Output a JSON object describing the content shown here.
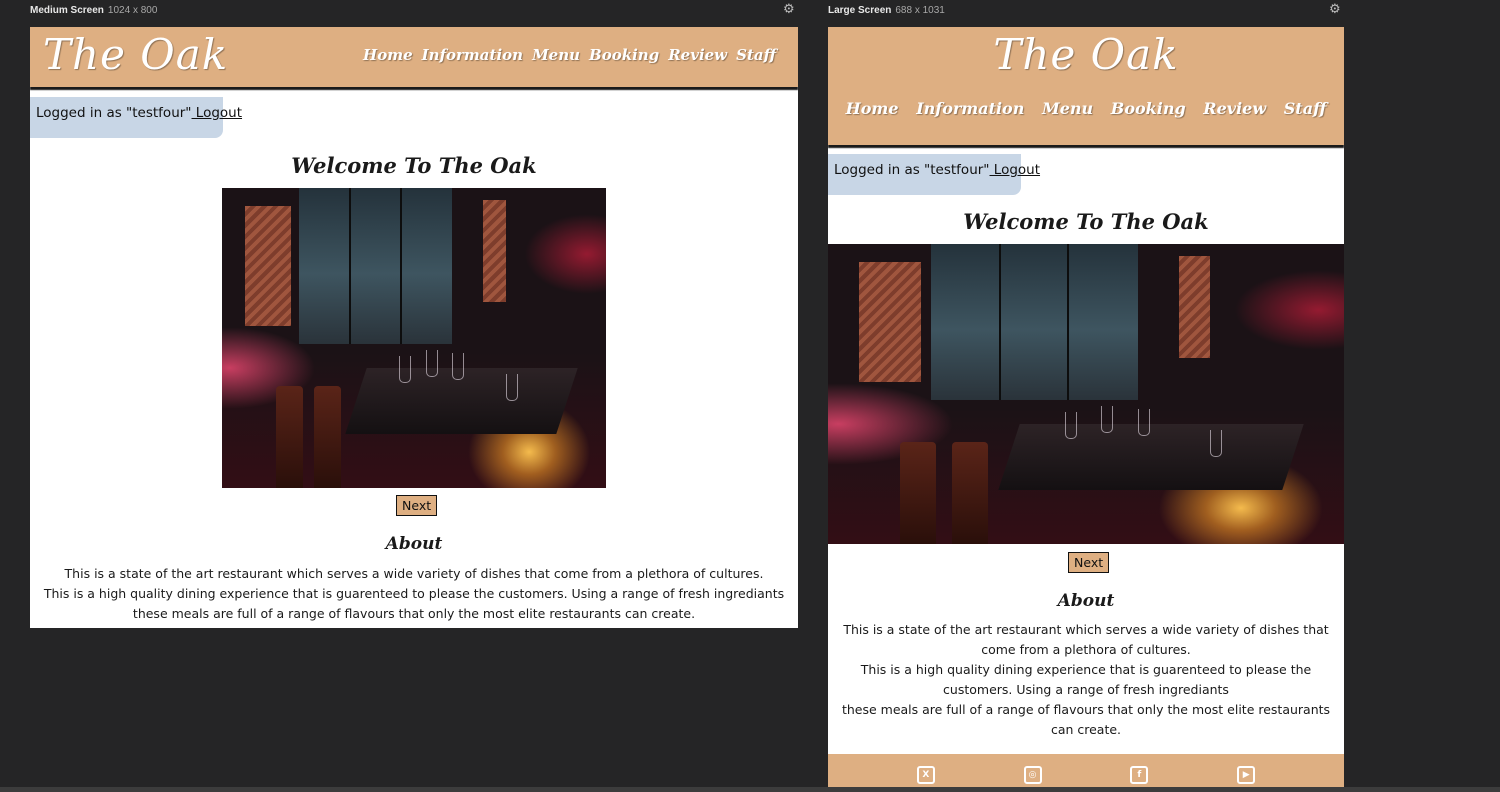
{
  "devtools": {
    "medium": {
      "label": "Medium Screen",
      "dims": "1024 x 800"
    },
    "large": {
      "label": "Large Screen",
      "dims": "688 x 1031"
    },
    "settings_icon": "gear-icon"
  },
  "site": {
    "brand": "The Oak",
    "nav": [
      "Home",
      "Information",
      "Menu",
      "Booking",
      "Review",
      "Staff"
    ],
    "login": {
      "text": "Logged in as \"testfour\"",
      "logout": " Logout"
    },
    "welcome": "Welcome To The Oak",
    "gallery": {
      "image": "restaurant-interior-photo",
      "next": "Next"
    },
    "about": {
      "title": "About",
      "line1": "This is a state of the art restaurant which serves a wide variety of dishes that come from a plethora of cultures.",
      "line2": "This is a high quality dining experience that is guarenteed to please the customers. Using a range of fresh ingrediants",
      "line3": "these meals are full of a range of flavours that only the most elite restaurants can create."
    },
    "footer_icons": [
      "x-twitter-icon",
      "instagram-icon",
      "facebook-icon",
      "youtube-icon"
    ]
  },
  "colors": {
    "header": "#deaf82",
    "login_box": "#c8d6e6",
    "background": "#252526"
  }
}
